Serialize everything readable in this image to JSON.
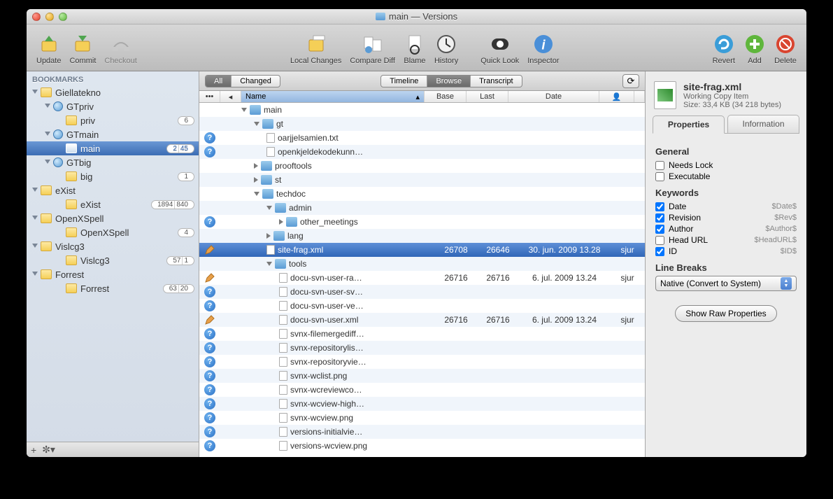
{
  "window": {
    "title": "main — Versions"
  },
  "toolbar": {
    "update": "Update",
    "commit": "Commit",
    "checkout": "Checkout",
    "local_changes": "Local Changes",
    "compare_diff": "Compare Diff",
    "blame": "Blame",
    "history": "History",
    "quick_look": "Quick Look",
    "inspector": "Inspector",
    "revert": "Revert",
    "add": "Add",
    "delete": "Delete"
  },
  "sidebar": {
    "header": "BOOKMARKS",
    "items": [
      {
        "label": "Giellatekno",
        "indent": 0,
        "type": "folder",
        "expanded": true
      },
      {
        "label": "GTpriv",
        "indent": 1,
        "type": "globe",
        "expanded": true
      },
      {
        "label": "priv",
        "indent": 2,
        "type": "folder",
        "badge": [
          "6"
        ]
      },
      {
        "label": "GTmain",
        "indent": 1,
        "type": "globe",
        "expanded": true
      },
      {
        "label": "main",
        "indent": 2,
        "type": "folder",
        "selected": true,
        "badge": [
          "2",
          "45"
        ]
      },
      {
        "label": "GTbig",
        "indent": 1,
        "type": "globe",
        "expanded": true
      },
      {
        "label": "big",
        "indent": 2,
        "type": "folder",
        "badge": [
          "1"
        ]
      },
      {
        "label": "eXist",
        "indent": 0,
        "type": "folder",
        "expanded": true
      },
      {
        "label": "eXist",
        "indent": 2,
        "type": "folder",
        "badge": [
          "1894",
          "840"
        ]
      },
      {
        "label": "OpenXSpell",
        "indent": 0,
        "type": "folder",
        "expanded": true
      },
      {
        "label": "OpenXSpell",
        "indent": 2,
        "type": "folder",
        "badge": [
          "4"
        ]
      },
      {
        "label": "Vislcg3",
        "indent": 0,
        "type": "folder",
        "expanded": true
      },
      {
        "label": "Vislcg3",
        "indent": 2,
        "type": "folder",
        "badge": [
          "57",
          "1"
        ]
      },
      {
        "label": "Forrest",
        "indent": 0,
        "type": "folder",
        "expanded": true
      },
      {
        "label": "Forrest",
        "indent": 2,
        "type": "folder",
        "badge": [
          "63",
          "20"
        ]
      }
    ]
  },
  "main": {
    "filter": {
      "all": "All",
      "changed": "Changed"
    },
    "view_tabs": {
      "timeline": "Timeline",
      "browse": "Browse",
      "transcript": "Transcript"
    },
    "columns": {
      "name": "Name",
      "base": "Base",
      "last": "Last",
      "date": "Date"
    },
    "rows": [
      {
        "indent": 0,
        "icon": "folder",
        "disc": "down",
        "name": "main",
        "status": ""
      },
      {
        "indent": 1,
        "icon": "folder",
        "disc": "down",
        "name": "gt",
        "status": ""
      },
      {
        "indent": 2,
        "icon": "file",
        "name": "oarjjelsamien.txt",
        "status": "q"
      },
      {
        "indent": 2,
        "icon": "file",
        "name": "openkjeldekodekunn…",
        "status": "q"
      },
      {
        "indent": 1,
        "icon": "folder",
        "disc": "right",
        "name": "prooftools",
        "status": ""
      },
      {
        "indent": 1,
        "icon": "folder",
        "disc": "right",
        "name": "st",
        "status": ""
      },
      {
        "indent": 1,
        "icon": "folder",
        "disc": "down",
        "name": "techdoc",
        "status": ""
      },
      {
        "indent": 2,
        "icon": "folder",
        "disc": "down",
        "name": "admin",
        "status": ""
      },
      {
        "indent": 3,
        "icon": "folder",
        "disc": "right",
        "name": "other_meetings",
        "status": "q"
      },
      {
        "indent": 2,
        "icon": "folder",
        "disc": "right",
        "name": "lang",
        "status": ""
      },
      {
        "indent": 2,
        "icon": "file",
        "name": "site-frag.xml",
        "status": "edit",
        "base": "26708",
        "last": "26646",
        "date": "30. jun. 2009 13.28",
        "author": "sjur",
        "selected": true
      },
      {
        "indent": 2,
        "icon": "folder",
        "disc": "down",
        "name": "tools",
        "status": ""
      },
      {
        "indent": 3,
        "icon": "file",
        "name": "docu-svn-user-ra…",
        "status": "edit",
        "base": "26716",
        "last": "26716",
        "date": "6. jul. 2009 13.24",
        "author": "sjur"
      },
      {
        "indent": 3,
        "icon": "file",
        "name": "docu-svn-user-sv…",
        "status": "q"
      },
      {
        "indent": 3,
        "icon": "file",
        "name": "docu-svn-user-ve…",
        "status": "q"
      },
      {
        "indent": 3,
        "icon": "file",
        "name": "docu-svn-user.xml",
        "status": "edit",
        "base": "26716",
        "last": "26716",
        "date": "6. jul. 2009 13.24",
        "author": "sjur"
      },
      {
        "indent": 3,
        "icon": "file",
        "name": "svnx-filemergediff…",
        "status": "q"
      },
      {
        "indent": 3,
        "icon": "file",
        "name": "svnx-repositorylis…",
        "status": "q"
      },
      {
        "indent": 3,
        "icon": "file",
        "name": "svnx-repositoryvie…",
        "status": "q"
      },
      {
        "indent": 3,
        "icon": "file",
        "name": "svnx-wclist.png",
        "status": "q"
      },
      {
        "indent": 3,
        "icon": "file",
        "name": "svnx-wcreviewco…",
        "status": "q"
      },
      {
        "indent": 3,
        "icon": "file",
        "name": "svnx-wcview-high…",
        "status": "q"
      },
      {
        "indent": 3,
        "icon": "file",
        "name": "svnx-wcview.png",
        "status": "q"
      },
      {
        "indent": 3,
        "icon": "file",
        "name": "versions-initialvie…",
        "status": "q"
      },
      {
        "indent": 3,
        "icon": "file",
        "name": "versions-wcview.png",
        "status": "q"
      }
    ]
  },
  "inspector": {
    "filename": "site-frag.xml",
    "kind": "Working Copy Item",
    "size": "Size: 33,4 KB (34 218 bytes)",
    "tabs": {
      "properties": "Properties",
      "information": "Information"
    },
    "general": {
      "header": "General",
      "needs_lock": "Needs Lock",
      "executable": "Executable"
    },
    "keywords": {
      "header": "Keywords",
      "items": [
        {
          "label": "Date",
          "val": "$Date$",
          "checked": true
        },
        {
          "label": "Revision",
          "val": "$Rev$",
          "checked": true
        },
        {
          "label": "Author",
          "val": "$Author$",
          "checked": true
        },
        {
          "label": "Head URL",
          "val": "$HeadURL$",
          "checked": false
        },
        {
          "label": "ID",
          "val": "$ID$",
          "checked": true
        }
      ]
    },
    "line_breaks": {
      "header": "Line Breaks",
      "value": "Native (Convert to System)"
    },
    "raw_button": "Show Raw Properties"
  }
}
